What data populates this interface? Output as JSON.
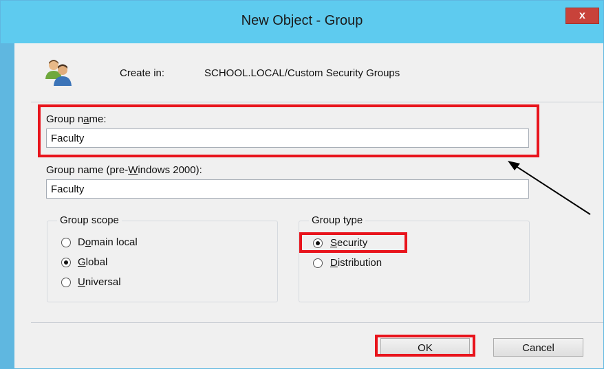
{
  "window": {
    "title": "New Object - Group",
    "close_label": "x"
  },
  "create_in": {
    "label": "Create in:",
    "path": "SCHOOL.LOCAL/Custom Security Groups"
  },
  "group_name": {
    "label_pre": "Group n",
    "label_accel": "a",
    "label_post": "me:",
    "value": "Faculty"
  },
  "group_name_pre2000": {
    "label_pre": "Group name (pre-",
    "label_accel": "W",
    "label_post": "indows 2000):",
    "value": "Faculty"
  },
  "group_scope": {
    "legend": "Group scope",
    "options": [
      {
        "pre": "D",
        "accel": "o",
        "post": "main local",
        "checked": false
      },
      {
        "pre": "",
        "accel": "G",
        "post": "lobal",
        "checked": true
      },
      {
        "pre": "",
        "accel": "U",
        "post": "niversal",
        "checked": false
      }
    ]
  },
  "group_type": {
    "legend": "Group type",
    "options": [
      {
        "pre": "",
        "accel": "S",
        "post": "ecurity",
        "checked": true
      },
      {
        "pre": "",
        "accel": "D",
        "post": "istribution",
        "checked": false
      }
    ]
  },
  "buttons": {
    "ok": "OK",
    "cancel": "Cancel"
  },
  "colors": {
    "titlebar": "#5ecbef",
    "close": "#c8423a",
    "highlight": "#e8141c",
    "dialog_bg": "#f0f0f0"
  },
  "icons": {
    "group": "users-group-icon",
    "arrow": "annotation-arrow"
  }
}
